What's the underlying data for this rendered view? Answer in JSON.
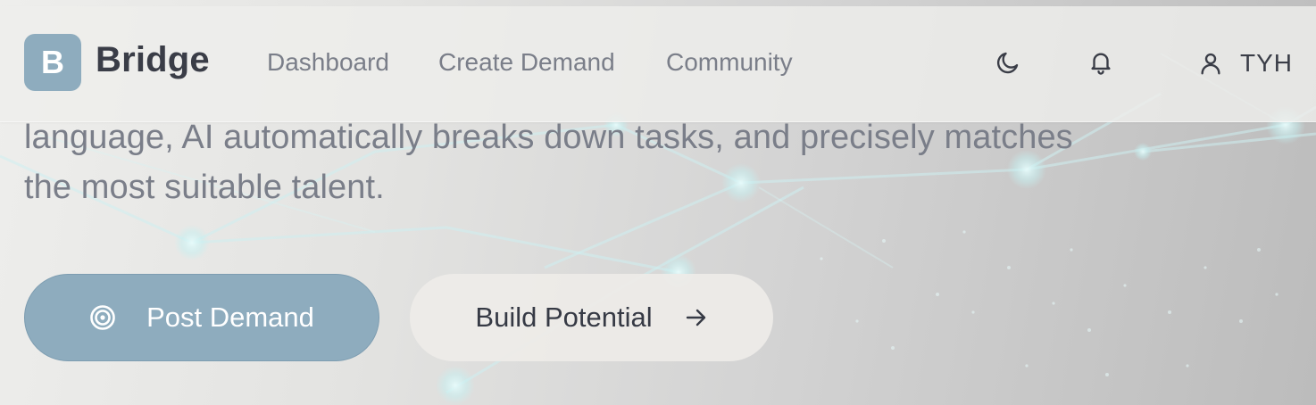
{
  "brand": {
    "logo_letter": "B",
    "name": "Bridge"
  },
  "nav": {
    "links": [
      {
        "label": "Dashboard"
      },
      {
        "label": "Create Demand"
      },
      {
        "label": "Community"
      }
    ],
    "theme_toggle_icon": "moon-icon",
    "notifications_icon": "bell-icon",
    "user": {
      "icon": "user-icon",
      "name": "TYH"
    }
  },
  "hero": {
    "description_line_1": "language, AI automatically breaks down tasks, and precisely matches",
    "description_line_2": "the most suitable talent."
  },
  "actions": {
    "primary": {
      "label": "Post Demand",
      "icon": "target-icon"
    },
    "secondary": {
      "label": "Build Potential",
      "icon": "arrow-right-icon"
    }
  },
  "colors": {
    "accent": "#8eacbe",
    "text_dark": "#3a3d47",
    "text_muted": "#7a7e89",
    "network_glow": "#bfeef0"
  }
}
